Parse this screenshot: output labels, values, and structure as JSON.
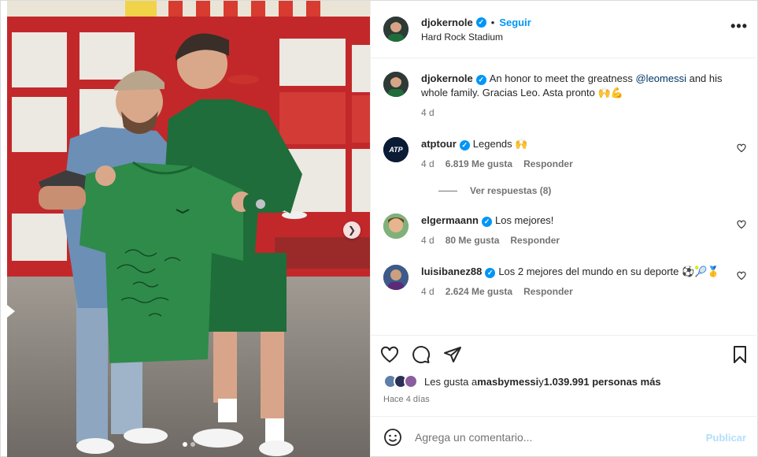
{
  "post": {
    "author": "djokernole",
    "follow_label": "Seguir",
    "separator": "•",
    "location": "Hard Rock Stadium",
    "more_icon": "more-horizontal-icon",
    "caption": {
      "username": "djokernole",
      "text_before": "An honor to meet the greatness ",
      "mention": "@leomessi",
      "text_after": " and his whole family. Gracias Leo. Asta pronto 🙌💪",
      "time": "4 d"
    }
  },
  "comments": [
    {
      "username": "atptour",
      "text": "Legends 🙌",
      "time": "4 d",
      "likes": "6.819 Me gusta",
      "reply": "Responder",
      "replies_label": "Ver respuestas (8)"
    },
    {
      "username": "elgermaann",
      "text": "Los mejores!",
      "time": "4 d",
      "likes": "80 Me gusta",
      "reply": "Responder"
    },
    {
      "username": "luisibanez88",
      "text": "Los 2 mejores del mundo en su deporte ⚽🎾🥇",
      "time": "4 d",
      "likes": "2.624 Me gusta",
      "reply": "Responder"
    }
  ],
  "likes_summary": {
    "prefix": "Les gusta a ",
    "user": "masbymessi",
    "middle": " y ",
    "count": "1.039.991 personas más"
  },
  "posted_ago": "Hace 4 días",
  "composer": {
    "placeholder": "Agrega un comentario...",
    "publish_label": "Publicar"
  },
  "colors": {
    "accent": "#0095f6",
    "shirt_green": "#2e8b4a",
    "locker_red": "#c4272a"
  }
}
